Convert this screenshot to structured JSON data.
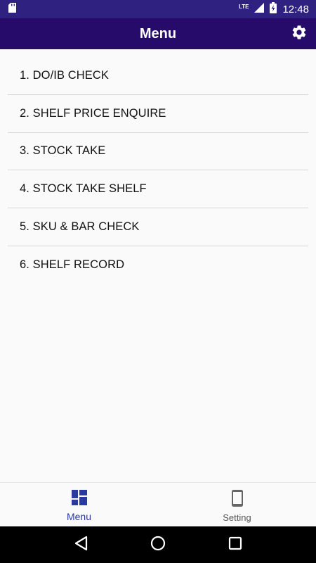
{
  "status_bar": {
    "time": "12:48",
    "network": "LTE",
    "icons": [
      "sd-card-icon",
      "signal-icon",
      "battery-charging-icon"
    ]
  },
  "app_bar": {
    "title": "Menu",
    "settings_icon": "gear-icon"
  },
  "menu": {
    "items": [
      {
        "label": "1. DO/IB CHECK"
      },
      {
        "label": "2. SHELF PRICE ENQUIRE"
      },
      {
        "label": "3. STOCK TAKE"
      },
      {
        "label": "4. STOCK TAKE SHELF"
      },
      {
        "label": "5. SKU & BAR CHECK"
      },
      {
        "label": "6. SHELF RECORD"
      }
    ]
  },
  "bottom_nav": {
    "items": [
      {
        "label": "Menu",
        "icon": "dashboard-icon",
        "active": true
      },
      {
        "label": "Setting",
        "icon": "phone-icon",
        "active": false
      }
    ]
  },
  "system_nav": {
    "buttons": [
      "back-icon",
      "home-icon",
      "recents-icon"
    ]
  },
  "colors": {
    "status_bar": "#2e2180",
    "app_bar": "#270b6b",
    "active_nav": "#2b3a9e",
    "inactive_nav": "#555555",
    "background": "#fafafa"
  }
}
